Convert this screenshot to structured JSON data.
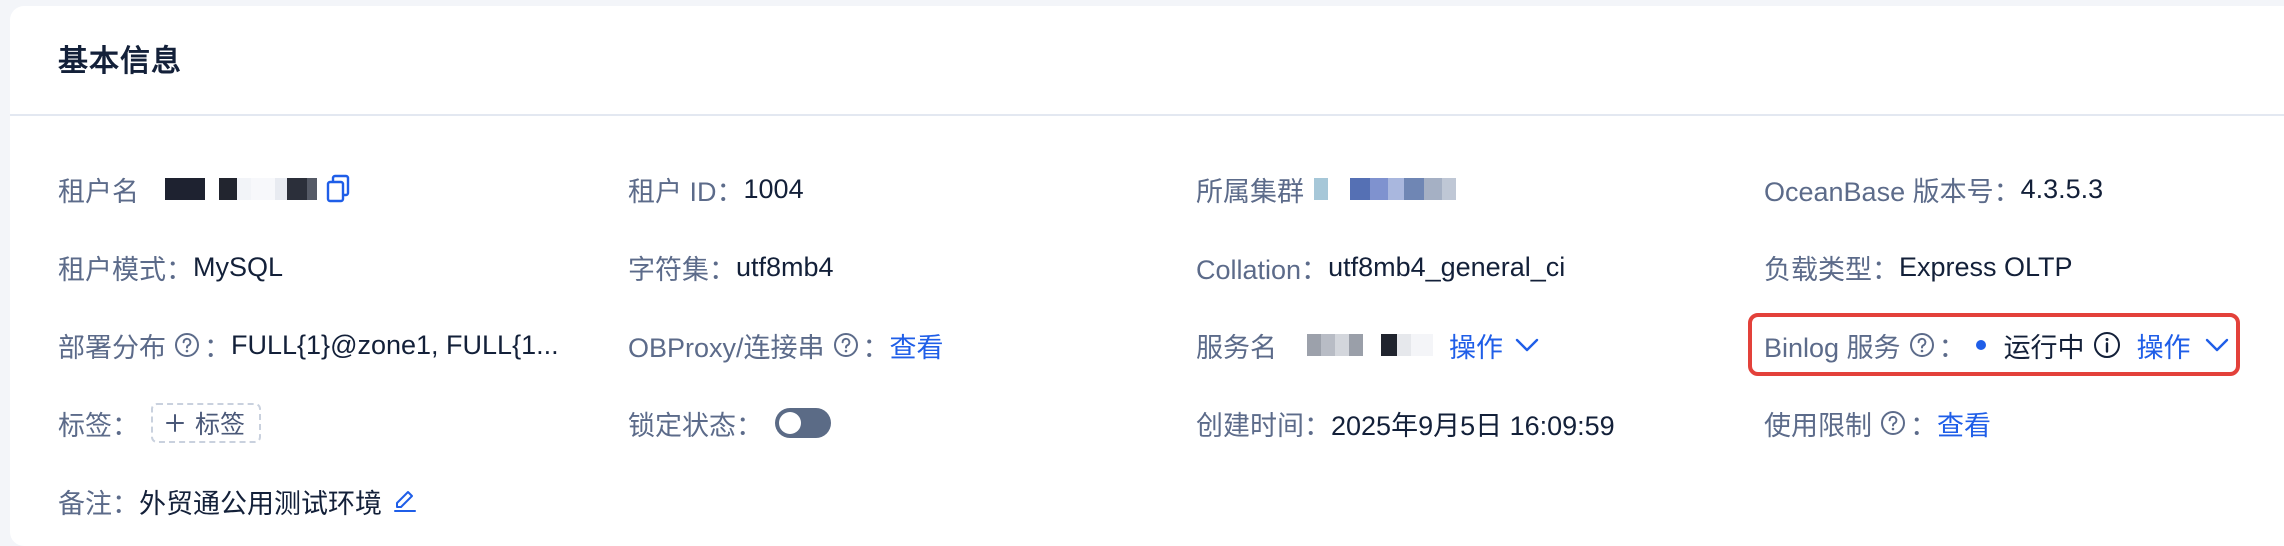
{
  "card": {
    "title": "基本信息"
  },
  "fields": {
    "tenant_name": {
      "label": "租户名"
    },
    "tenant_id": {
      "label": "租户 ID：",
      "value": "1004"
    },
    "cluster": {
      "label": "所属集群"
    },
    "ob_version": {
      "label": "OceanBase 版本号：",
      "value": "4.3.5.3"
    },
    "tenant_mode": {
      "label": "租户模式：",
      "value": "MySQL"
    },
    "charset": {
      "label": "字符集：",
      "value": "utf8mb4"
    },
    "collation": {
      "label": "Collation：",
      "value": "utf8mb4_general_ci"
    },
    "workload": {
      "label": "负载类型：",
      "value": "Express OLTP"
    },
    "deployment": {
      "label": "部署分布",
      "sep": "：",
      "value": "FULL{1}@zone1, FULL{1..."
    },
    "obproxy": {
      "label": "OBProxy/连接串",
      "sep": "：",
      "link": "查看"
    },
    "service_name": {
      "label": "服务名",
      "action": "操作"
    },
    "binlog": {
      "label": "Binlog 服务",
      "sep": "：",
      "status": "运行中",
      "action": "操作"
    },
    "tags": {
      "label": "标签：",
      "add_label": "标签"
    },
    "lock_status": {
      "label": "锁定状态：",
      "enabled": false
    },
    "created_time": {
      "label": "创建时间：",
      "value": "2025年9月5日 16:09:59"
    },
    "usage_limit": {
      "label": "使用限制",
      "sep": "：",
      "link": "查看"
    },
    "remark": {
      "label": "备注：",
      "value": "外贸通公用测试环境"
    }
  },
  "colors": {
    "link": "#1f5ee8",
    "label": "#5c6b8a",
    "value": "#132039",
    "highlight": "#e3413a",
    "status_running": "#1f5ee8"
  },
  "icons": {
    "copy": "copy-icon",
    "help": "question-circle-icon",
    "chevron": "chevron-down-icon",
    "info": "info-circle-icon",
    "edit": "edit-icon",
    "plus": "plus-icon"
  }
}
